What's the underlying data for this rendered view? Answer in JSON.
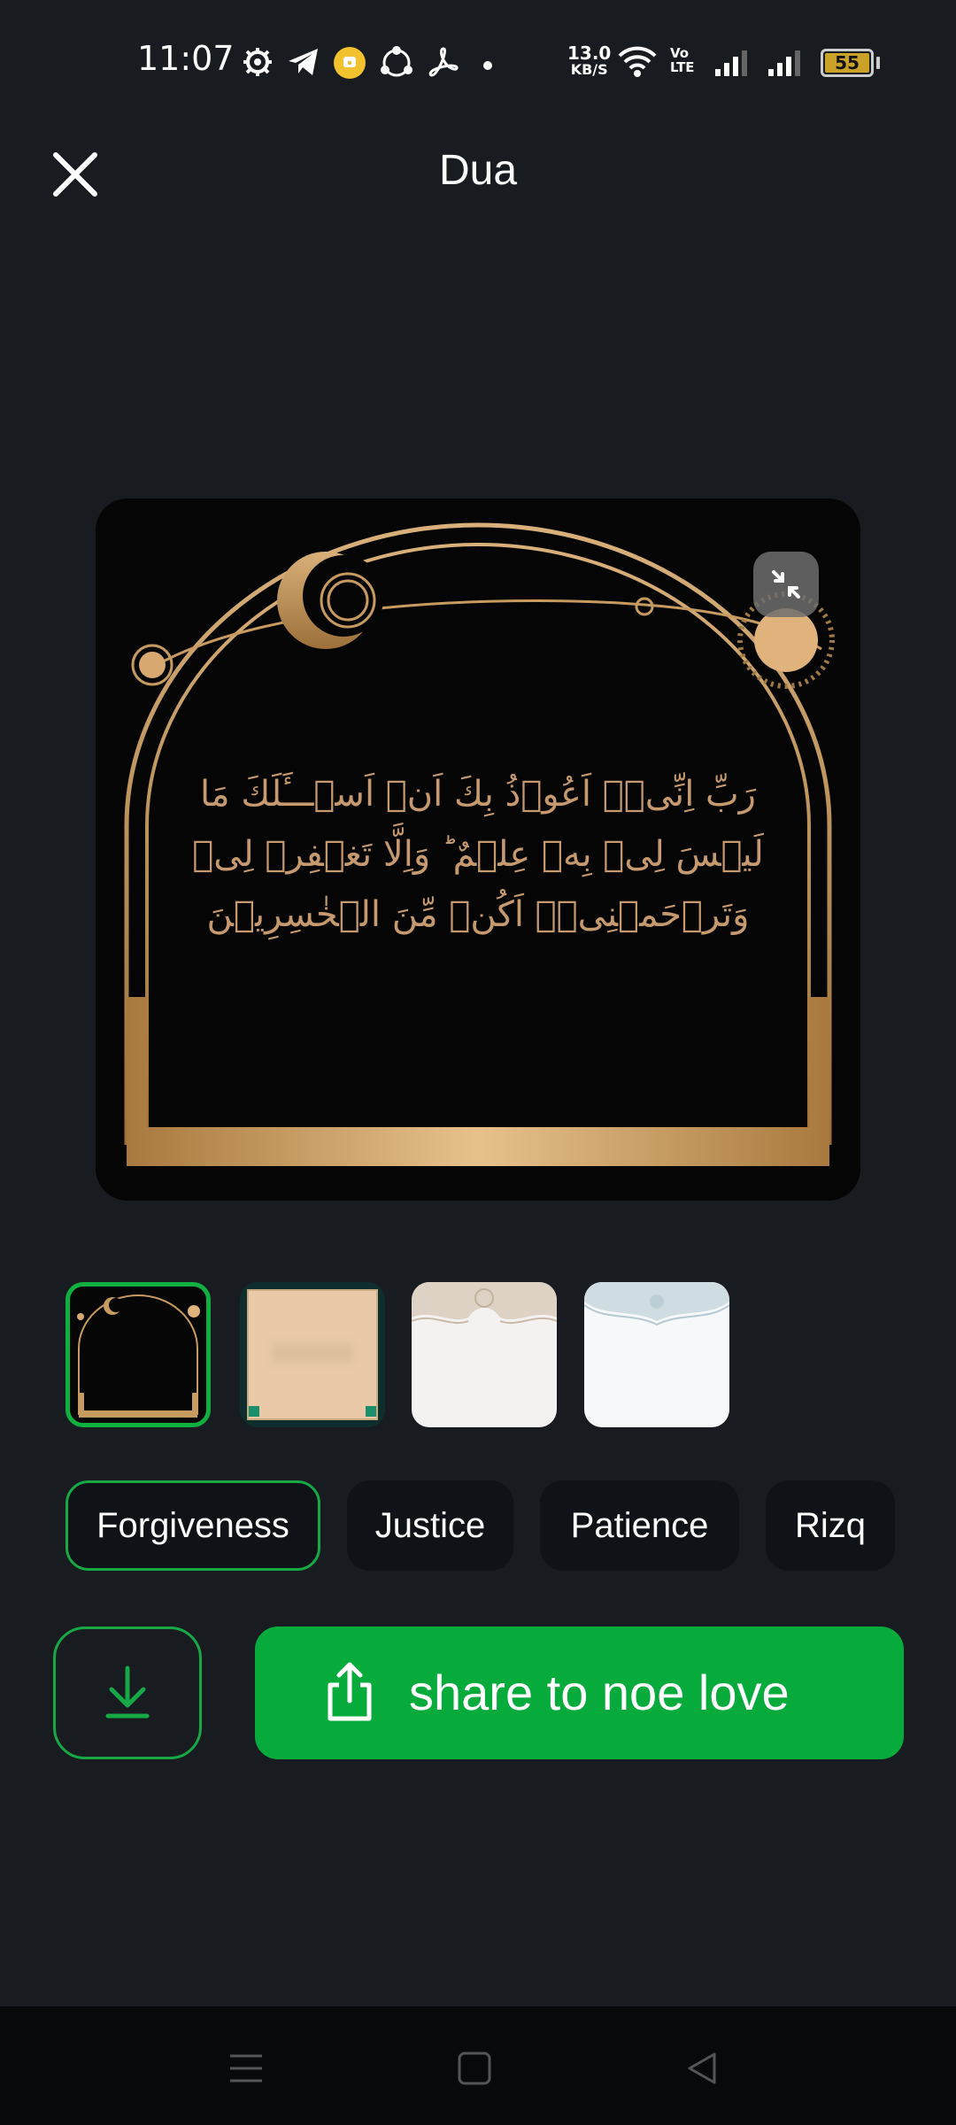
{
  "status_bar": {
    "time": "11:07",
    "net_speed_value": "13.0",
    "net_speed_unit": "KB/S",
    "volte": "Vo\nLTE",
    "battery": "55",
    "icons": [
      "settings-gear-icon",
      "telegram-icon",
      "yellow-app-icon",
      "shareit-icon",
      "acrobat-icon",
      "dot-icon",
      "wifi-icon",
      "volte-icon",
      "signal-1-icon",
      "signal-2-icon",
      "battery-icon"
    ]
  },
  "header": {
    "title": "Dua"
  },
  "card": {
    "dua_text": "رَبِّ اِنِّىۡۤ اَعُوۡذُ بِكَ اَنۡ اَسۡـــَٔلَكَ مَا لَيۡسَ لِىۡ بِهٖ عِلۡمٌ ‌ؕ وَاِلَّا تَغۡفِرۡ لِىۡ وَتَرۡحَمۡنِىۡۤ اَكُنۡ مِّنَ الۡخٰسِرِيۡنَ",
    "text_color": "#c69a6e",
    "frame_color": "#c79a5f"
  },
  "templates": [
    {
      "name": "black-gold-arch",
      "selected": true
    },
    {
      "name": "beige-teal-frame",
      "selected": false
    },
    {
      "name": "white-ornament",
      "selected": false
    },
    {
      "name": "white-lace",
      "selected": false
    }
  ],
  "categories": [
    {
      "label": "Forgiveness",
      "selected": true
    },
    {
      "label": "Justice",
      "selected": false
    },
    {
      "label": "Patience",
      "selected": false
    },
    {
      "label": "Rizq",
      "selected": false
    }
  ],
  "actions": {
    "share_label": "share to noe love"
  },
  "colors": {
    "accent": "#06ab3c",
    "background": "#181c20",
    "chip_bg": "#0f1216"
  }
}
